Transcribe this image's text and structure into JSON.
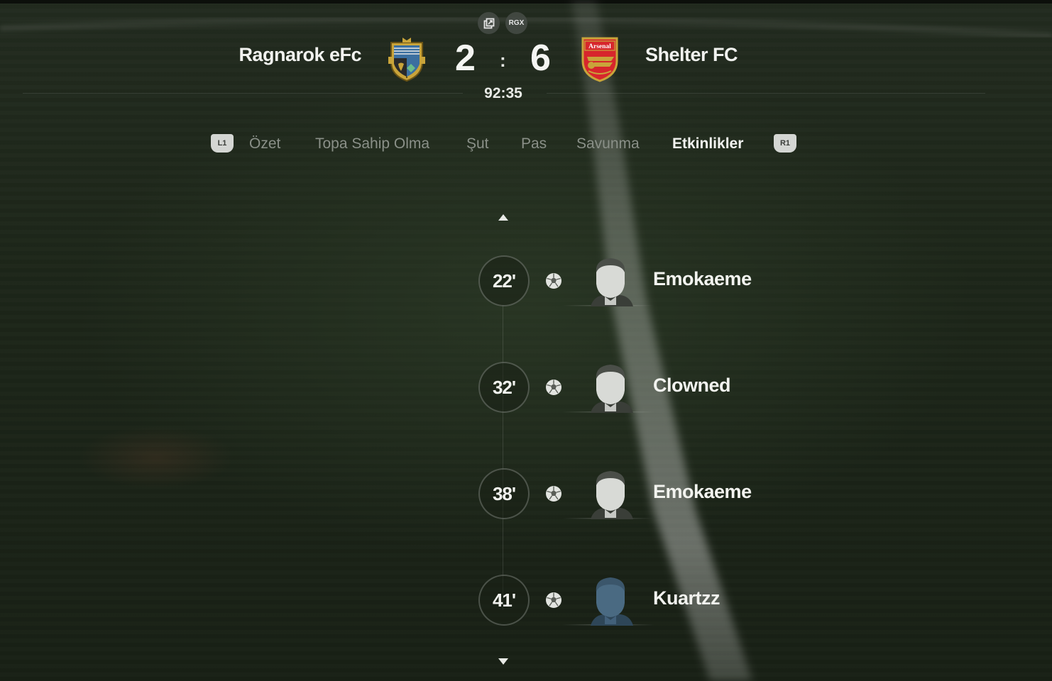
{
  "top_icons": {
    "popout_icon": "popout-icon",
    "badge_label": "RGX"
  },
  "match": {
    "home_team": "Ragnarok eFc",
    "away_team": "Shelter FC",
    "home_score": "2",
    "away_score": "6",
    "separator": ":",
    "clock": "92:35",
    "away_crest_text": "Arsenal"
  },
  "tabs": {
    "left_shoulder": "L1",
    "right_shoulder": "R1",
    "items": [
      {
        "label": "Özet",
        "active": false
      },
      {
        "label": "Topa Sahip Olma",
        "active": false
      },
      {
        "label": "Şut",
        "active": false
      },
      {
        "label": "Pas",
        "active": false
      },
      {
        "label": "Savunma",
        "active": false
      },
      {
        "label": "Etkinlikler",
        "active": true
      }
    ]
  },
  "events": [
    {
      "minute": "22'",
      "type": "goal",
      "icon": "football-icon",
      "player": "Emokaeme"
    },
    {
      "minute": "32'",
      "type": "goal",
      "icon": "football-icon",
      "player": "Clowned"
    },
    {
      "minute": "38'",
      "type": "goal",
      "icon": "football-icon",
      "player": "Emokaeme"
    },
    {
      "minute": "41'",
      "type": "goal",
      "icon": "football-icon",
      "player": "Kuartzz"
    }
  ],
  "colors": {
    "accent_text": "#f2f3ef",
    "inactive_tab": "#8a9088",
    "away_crest_red": "#d7262c",
    "home_crest_blue": "#3b6fa0"
  }
}
